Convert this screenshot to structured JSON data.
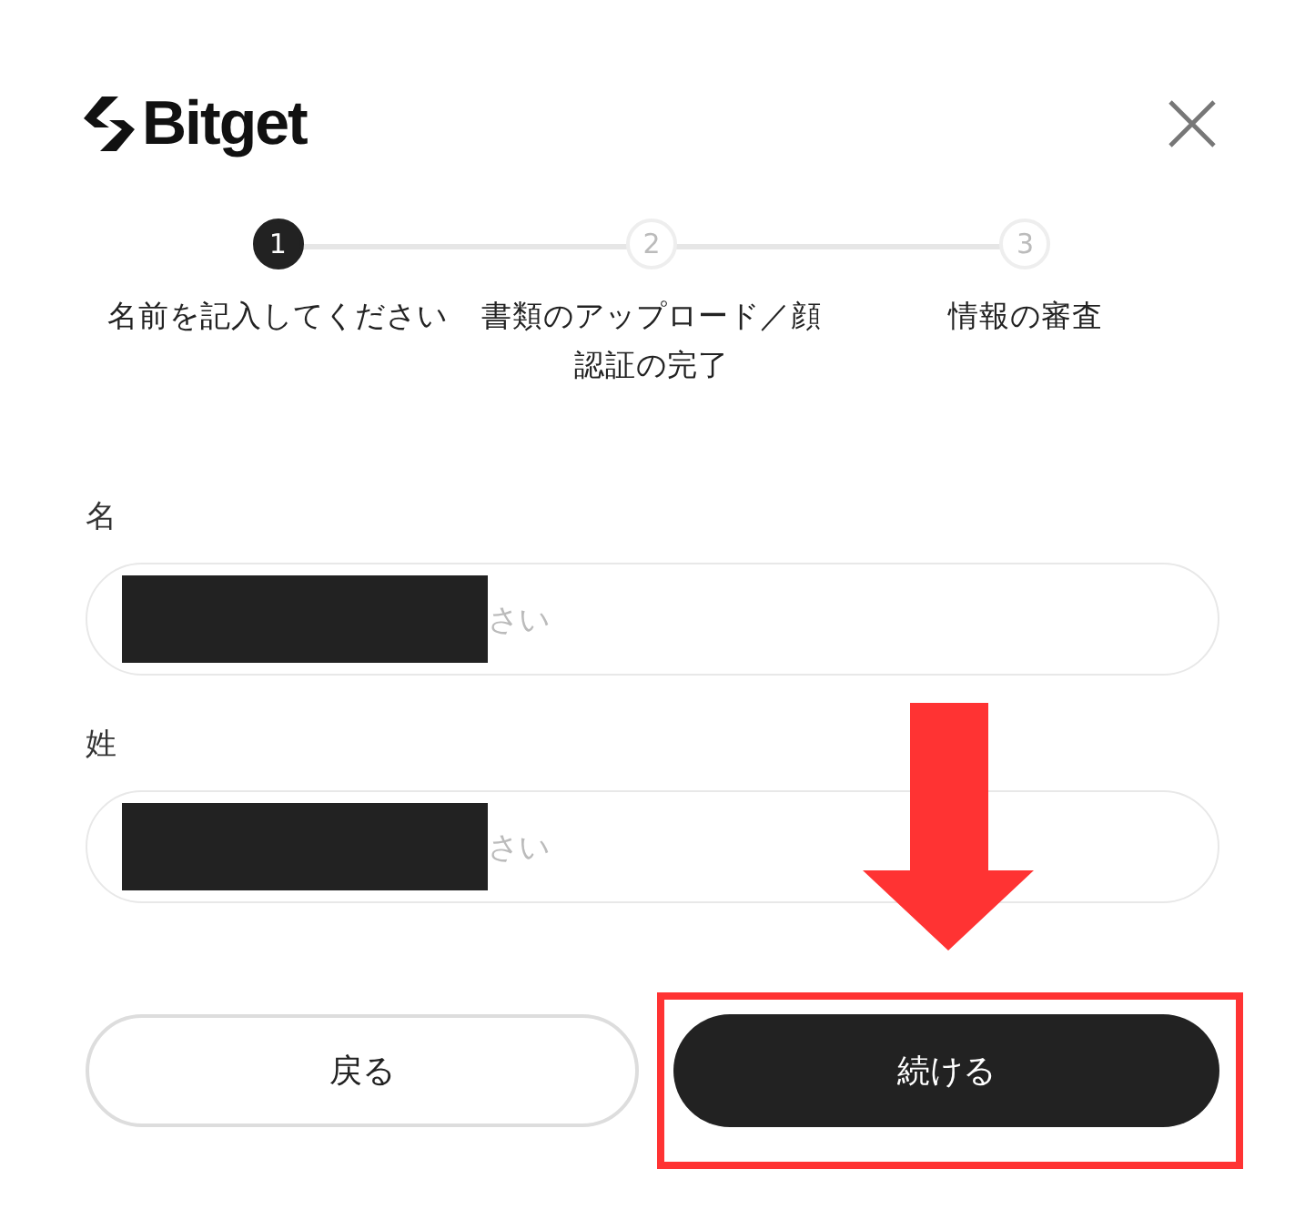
{
  "logo": {
    "text": "Bitget"
  },
  "steps": [
    {
      "number": "1",
      "label": "名前を記入してください",
      "selected": true
    },
    {
      "number": "2",
      "label": "書類のアップロード／顔認証の完了",
      "selected": false
    },
    {
      "number": "3",
      "label": "情報の審査",
      "selected": false
    }
  ],
  "fields": [
    {
      "label": "名",
      "placeholder": "さい",
      "redacted": true
    },
    {
      "label": "姓",
      "placeholder": "さい",
      "redacted": true
    }
  ],
  "buttons": [
    {
      "label": "戻る",
      "kind": "secondary"
    },
    {
      "label": "続ける",
      "kind": "primary"
    }
  ],
  "arrow_annotation": {
    "color": "#ff3333"
  },
  "highlight_annotation": {
    "color": "#ff3333"
  }
}
